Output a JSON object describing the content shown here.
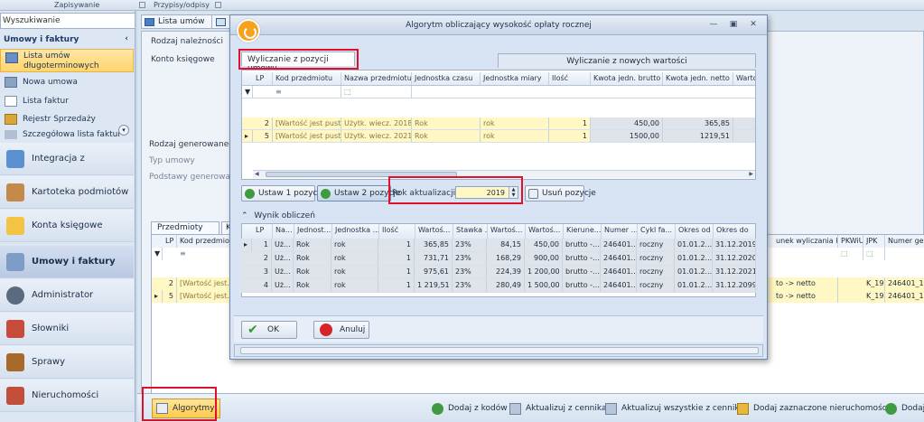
{
  "ribbon": {
    "groups": [
      "Zapisywanie",
      "Przypisy/odpisy"
    ]
  },
  "sidebar": {
    "search_value": "Wyszukiwanie",
    "section_title": "Umowy i faktury",
    "sub_items": [
      {
        "label": "Lista umów długoterminowych"
      },
      {
        "label": "Nowa umowa"
      },
      {
        "label": "Lista faktur"
      },
      {
        "label": "Rejestr Sprzedaży"
      },
      {
        "label": "Szczegółowa lista faktur"
      }
    ],
    "nav": [
      {
        "label": "Integracja z Wymiarem"
      },
      {
        "label": "Kartoteka podmiotów"
      },
      {
        "label": "Konta księgowe"
      },
      {
        "label": "Umowy i faktury"
      },
      {
        "label": "Administrator"
      },
      {
        "label": "Słowniki"
      },
      {
        "label": "Sprawy"
      },
      {
        "label": "Nieruchomości"
      }
    ]
  },
  "main": {
    "tabs": [
      {
        "label": "Lista umów"
      }
    ],
    "form": {
      "rodzaj_naleznosci": "Rodzaj należności",
      "konto_ksiegowe": "Konto księgowe",
      "rodzaj_generowanego": "Rodzaj generowanego po",
      "typ_umowy": "Typ umowy",
      "podstawy": "Podstawy generowania h"
    },
    "bottom_tabs": [
      "Przedmioty umowy",
      "Ko"
    ],
    "bg_grid": {
      "headers": [
        "LP",
        "Kod przedmiotu"
      ],
      "right_headers": [
        "unek wyliczania kwot",
        "PKWiU",
        "JPK",
        "Numer geod"
      ],
      "filter_glyph": "≡",
      "rows": [
        {
          "lp": "2",
          "kod": "[Wartość jest...",
          "kier": "to -> netto",
          "jpk": "K_19",
          "geod": "246401_1.0"
        },
        {
          "lp": "5",
          "kod": "[Wartość jest...",
          "kier": "to -> netto",
          "jpk": "K_19",
          "geod": "246401_1.0"
        }
      ]
    }
  },
  "toolbar": {
    "algorytmy": "Algorytmy",
    "buttons": [
      {
        "label": "Dodaj z kodów"
      },
      {
        "label": "Aktualizuj z cennika"
      },
      {
        "label": "Aktualizuj wszystkie z cennika"
      },
      {
        "label": "Dodaj zaznaczone nieruchomości"
      },
      {
        "label": "Dodaj"
      }
    ]
  },
  "dialog": {
    "title": "Algorytm obliczający wysokość opłaty rocznej",
    "tab_active": "Wyliczanie z pozycji umowy",
    "tab_inactive": "Wyliczanie z nowych wartości",
    "grid1": {
      "headers": [
        "LP",
        "Kod przedmiotu",
        "Nazwa przedmiotu",
        "Jednostka czasu",
        "Jednostka miary",
        "Ilość",
        "Kwota jedn. brutto",
        "Kwota jedn. netto",
        "Wartoś"
      ],
      "filter_glyph": "≡",
      "rows": [
        {
          "lp": "2",
          "kod": "[Wartość jest pusta]",
          "nazwa": "Użytk. wiecz. 2018",
          "czas": "Rok",
          "miara": "rok",
          "ilosc": "1",
          "brutto": "450,00",
          "netto": "365,85"
        },
        {
          "lp": "5",
          "kod": "[Wartość jest pusta]",
          "nazwa": "Użytk. wiecz. 2021",
          "czas": "Rok",
          "miara": "rok",
          "ilosc": "1",
          "brutto": "1500,00",
          "netto": "1219,51"
        }
      ]
    },
    "actions": {
      "ustaw1": "Ustaw 1 pozycje",
      "ustaw2": "Ustaw 2 pozycje",
      "rok_label": "Rok aktualizacji",
      "rok_value": "2019",
      "usun": "Usuń pozycje"
    },
    "results_title": "Wynik obliczeń",
    "grid2": {
      "headers": [
        "LP",
        "Na...",
        "Jednost...",
        "Jednostka ...",
        "Ilość",
        "Wartoś...",
        "Stawka ...",
        "Wartoś...",
        "Wartoś...",
        "Kierune...",
        "Numer ...",
        "Cykl fa...",
        "Okres od",
        "Okres do"
      ],
      "rows": [
        {
          "lp": "1",
          "na": "Uż...",
          "j1": "Rok",
          "j2": "rok",
          "il": "1",
          "w1": "365,85",
          "st": "23%",
          "w2": "84,15",
          "w3": "450,00",
          "kier": "brutto -...",
          "num": "246401...",
          "cykl": "roczny",
          "od": "01.01.2...",
          "do": "31.12.2019"
        },
        {
          "lp": "2",
          "na": "Uż...",
          "j1": "Rok",
          "j2": "rok",
          "il": "1",
          "w1": "731,71",
          "st": "23%",
          "w2": "168,29",
          "w3": "900,00",
          "kier": "brutto -...",
          "num": "246401...",
          "cykl": "roczny",
          "od": "01.01.2...",
          "do": "31.12.2020"
        },
        {
          "lp": "3",
          "na": "Uż...",
          "j1": "Rok",
          "j2": "rok",
          "il": "1",
          "w1": "975,61",
          "st": "23%",
          "w2": "224,39",
          "w3": "1 200,00",
          "kier": "brutto -...",
          "num": "246401...",
          "cykl": "roczny",
          "od": "01.01.2...",
          "do": "31.12.2021"
        },
        {
          "lp": "4",
          "na": "Uż...",
          "j1": "Rok",
          "j2": "rok",
          "il": "1",
          "w1": "1 219,51",
          "st": "23%",
          "w2": "280,49",
          "w3": "1 500,00",
          "kier": "brutto -...",
          "num": "246401...",
          "cykl": "roczny",
          "od": "01.01.2...",
          "do": "31.12.2099"
        }
      ]
    },
    "ok": "OK",
    "cancel": "Anuluj"
  },
  "colors": {
    "highlight": "#e0112b",
    "selected": "#ffd46b",
    "yellow_row": "#fff8c4"
  }
}
